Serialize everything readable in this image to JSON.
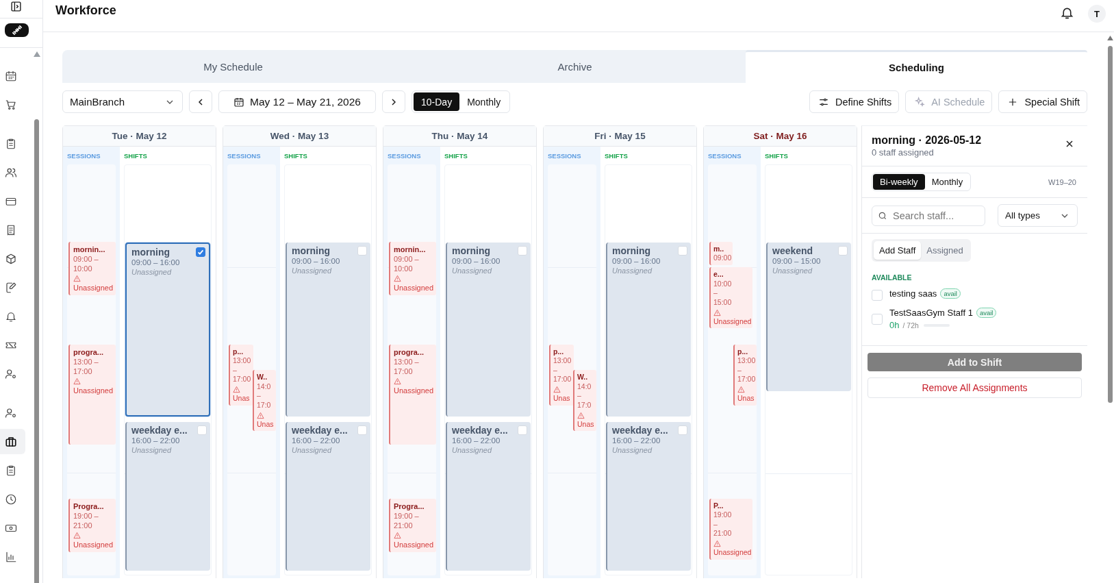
{
  "sidebar": {
    "groups": [
      [
        {
          "selected": false
        },
        {
          "selected": false
        }
      ],
      [
        {
          "selected": false
        },
        {
          "selected": false
        },
        {
          "selected": false
        },
        {
          "selected": false
        },
        {
          "selected": false
        },
        {
          "selected": false
        },
        {
          "selected": false
        },
        {
          "selected": false
        },
        {
          "selected": false
        }
      ],
      [
        {
          "selected": false
        },
        {
          "selected": true
        },
        {
          "selected": false
        },
        {
          "selected": false
        },
        {
          "selected": false
        },
        {
          "selected": false
        }
      ]
    ]
  },
  "header": {
    "title": "Workforce",
    "avatar": "T"
  },
  "tabs": [
    {
      "label": "My Schedule",
      "selected": false
    },
    {
      "label": "Archive",
      "selected": false
    },
    {
      "label": "Scheduling",
      "selected": true
    }
  ],
  "toolbar": {
    "branch": "MainBranch",
    "date_range": "May 12 – May 21, 2026",
    "views": [
      {
        "label": "10-Day",
        "selected": true
      },
      {
        "label": "Monthly",
        "selected": false
      }
    ],
    "actions": [
      {
        "label": "Define Shifts",
        "kind": "sliders",
        "disabled": false
      },
      {
        "label": "AI Schedule",
        "kind": "sparkle",
        "disabled": true
      },
      {
        "label": "Special Shift",
        "kind": "plus",
        "disabled": false
      }
    ]
  },
  "days": [
    {
      "label": "Tue · May 12",
      "weekend": false,
      "sessions_label": "SESSIONS",
      "shifts_label": "SHIFTS",
      "sessions": [
        {
          "title": "mornin...",
          "time": "09:00 – 10:00",
          "status": "Unassigned",
          "kind": "full"
        },
        {
          "title": "progra...",
          "time": "13:00 – 17:00",
          "status": "Unassigned",
          "kind": "full"
        },
        {
          "title": "Progra...",
          "time": "19:00 – 21:00",
          "status": "Unassigned",
          "kind": "full"
        }
      ],
      "shifts": [
        {
          "title": "morning",
          "time": "09:00 – 16:00",
          "status": "Unassigned",
          "checked": true,
          "selected": true
        },
        {
          "title": "weekday e...",
          "time": "16:00 – 22:00",
          "status": "Unassigned",
          "checked": false,
          "selected": false
        }
      ]
    },
    {
      "label": "Wed · May 13",
      "weekend": false,
      "sessions_label": "SESSIONS",
      "shifts_label": "SHIFTS",
      "sessions": [
        {
          "title": "p...",
          "time": "13:00 – 17:00",
          "status": "Unas",
          "kind": "left"
        },
        {
          "title": "W..",
          "time": "14:0 – 17:0",
          "status": "Unas",
          "kind": "right"
        }
      ],
      "shifts": [
        {
          "title": "morning",
          "time": "09:00 – 16:00",
          "status": "Unassigned",
          "checked": false,
          "selected": false
        },
        {
          "title": "weekday e...",
          "time": "16:00 – 22:00",
          "status": "Unassigned",
          "checked": false,
          "selected": false
        }
      ]
    },
    {
      "label": "Thu · May 14",
      "weekend": false,
      "sessions_label": "SESSIONS",
      "shifts_label": "SHIFTS",
      "sessions": [
        {
          "title": "mornin...",
          "time": "09:00 – 10:00",
          "status": "Unassigned",
          "kind": "full"
        },
        {
          "title": "progra...",
          "time": "13:00 – 17:00",
          "status": "Unassigned",
          "kind": "full"
        },
        {
          "title": "Progra...",
          "time": "19:00 – 21:00",
          "status": "Unassigned",
          "kind": "full"
        }
      ],
      "shifts": [
        {
          "title": "morning",
          "time": "09:00 – 16:00",
          "status": "Unassigned",
          "checked": false,
          "selected": false
        },
        {
          "title": "weekday e...",
          "time": "16:00 – 22:00",
          "status": "Unassigned",
          "checked": false,
          "selected": false
        }
      ]
    },
    {
      "label": "Fri · May 15",
      "weekend": false,
      "sessions_label": "SESSIONS",
      "shifts_label": "SHIFTS",
      "sessions": [
        {
          "title": "p...",
          "time": "13:00 – 17:00",
          "status": "Unas",
          "kind": "left"
        },
        {
          "title": "W..",
          "time": "14:0 – 17:0",
          "status": "Unas",
          "kind": "right"
        }
      ],
      "shifts": [
        {
          "title": "morning",
          "time": "09:00 – 16:00",
          "status": "Unassigned",
          "checked": false,
          "selected": false
        },
        {
          "title": "weekday e...",
          "time": "16:00 – 22:00",
          "status": "Unassigned",
          "checked": false,
          "selected": false
        }
      ]
    },
    {
      "label": "Sat · May 16",
      "weekend": true,
      "sessions_label": "SESSIONS",
      "shifts_label": "SHIFTS",
      "sessions": [
        {
          "title": "m..",
          "time": "09:00",
          "kind": "left"
        },
        {
          "title": "e...",
          "time": "10:00 – 15:00",
          "status": "Unassigned",
          "kind": "left"
        },
        {
          "title": "p...",
          "time": "13:00 – 17:00",
          "status": "Unas",
          "kind": "right"
        },
        {
          "title": "P...",
          "time": "19:00 – 21:00",
          "status": "Unassigned",
          "kind": "left"
        }
      ],
      "shifts": [
        {
          "title": "weekend",
          "time": "09:00 – 15:00",
          "status": "Unassigned",
          "checked": false,
          "selected": false
        }
      ]
    }
  ],
  "panel": {
    "title": "morning · 2026-05-12",
    "subtitle": "0 staff assigned",
    "periods": [
      {
        "label": "Bi-weekly",
        "selected": true
      },
      {
        "label": "Monthly",
        "selected": false
      }
    ],
    "week": "W19–20",
    "search": {
      "placeholder": "Search staff..."
    },
    "type_filter": "All types",
    "modes": [
      {
        "label": "Add Staff",
        "selected": true
      },
      {
        "label": "Assigned",
        "selected": false
      }
    ],
    "section": "AVAILABLE",
    "staff": [
      {
        "name": "testing saas",
        "badge": "avail",
        "checked": false
      },
      {
        "name": "TestSaasGym Staff 1",
        "badge": "avail",
        "checked": false,
        "hours": "0h",
        "limit": "/ 72h",
        "level": 0
      }
    ],
    "add_button": {
      "label": "Add to Shift",
      "disabled": true
    },
    "remove_button": "Remove All Assignments"
  }
}
